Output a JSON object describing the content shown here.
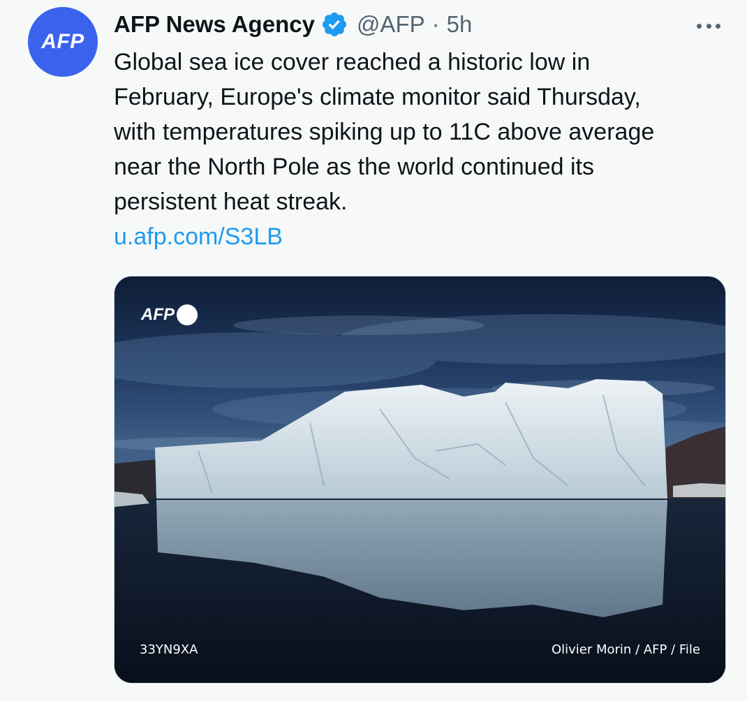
{
  "tweet": {
    "author": {
      "avatar_text": "AFP",
      "display_name": "AFP News Agency",
      "handle": "@AFP",
      "separator": "·",
      "time": "5h",
      "verified": true
    },
    "text_lines": [
      "Global sea ice cover reached a historic low in",
      "February, Europe's climate monitor said Thursday,",
      "with temperatures spiking up to 11C above average",
      "near the North Pole as the world continued its",
      "persistent heat streak."
    ],
    "link": "u.afp.com/S3LB",
    "media": {
      "watermark": "AFP",
      "photo_id": "33YN9XA",
      "credit": "Olivier Morin / AFP / File"
    }
  },
  "colors": {
    "avatar_bg": "#3a62ed",
    "verified_badge": "#1d9bf0",
    "link": "#1d9bf0",
    "secondary_text": "#536471",
    "background": "#f7f9f9"
  },
  "icons": {
    "verified": "verified-badge-icon",
    "more": "more-options-icon"
  }
}
